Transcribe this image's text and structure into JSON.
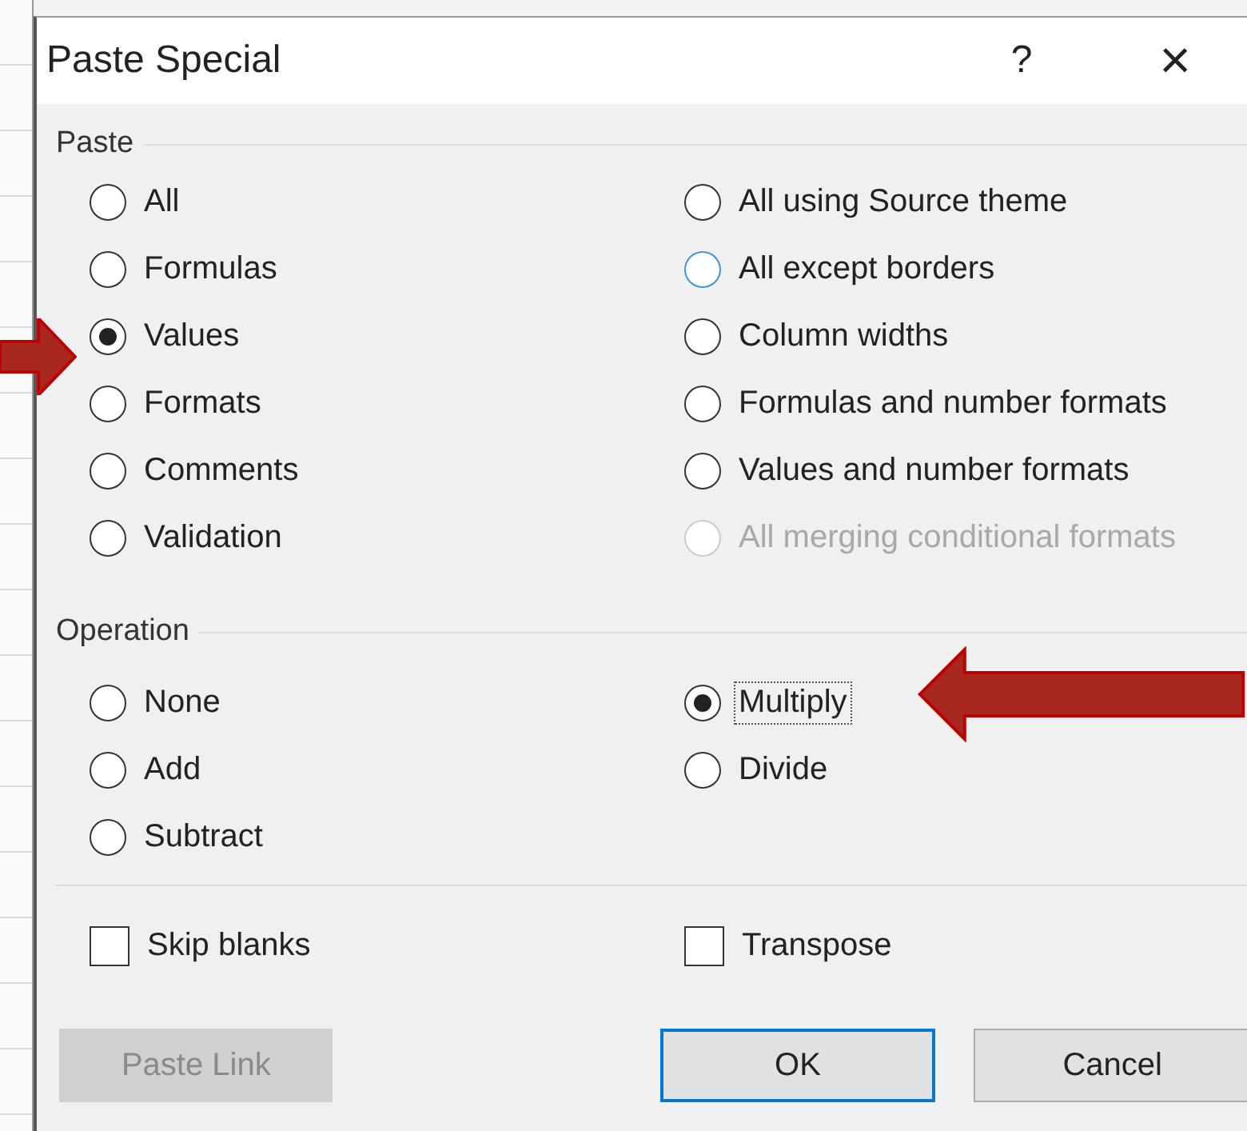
{
  "window": {
    "title": "Paste Special",
    "help": "?",
    "close": "×"
  },
  "paste": {
    "label": "Paste",
    "left": [
      {
        "label": "All",
        "selected": false,
        "disabled": false,
        "hover": false
      },
      {
        "label": "Formulas",
        "selected": false,
        "disabled": false,
        "hover": false
      },
      {
        "label": "Values",
        "selected": true,
        "disabled": false,
        "hover": false
      },
      {
        "label": "Formats",
        "selected": false,
        "disabled": false,
        "hover": false
      },
      {
        "label": "Comments",
        "selected": false,
        "disabled": false,
        "hover": false
      },
      {
        "label": "Validation",
        "selected": false,
        "disabled": false,
        "hover": false
      }
    ],
    "right": [
      {
        "label": "All using Source theme",
        "selected": false,
        "disabled": false,
        "hover": false
      },
      {
        "label": "All except borders",
        "selected": false,
        "disabled": false,
        "hover": true
      },
      {
        "label": "Column widths",
        "selected": false,
        "disabled": false,
        "hover": false
      },
      {
        "label": "Formulas and number formats",
        "selected": false,
        "disabled": false,
        "hover": false
      },
      {
        "label": "Values and number formats",
        "selected": false,
        "disabled": false,
        "hover": false
      },
      {
        "label": "All merging conditional formats",
        "selected": false,
        "disabled": true,
        "hover": false
      }
    ]
  },
  "operation": {
    "label": "Operation",
    "left": [
      {
        "label": "None",
        "selected": false,
        "focused": false
      },
      {
        "label": "Add",
        "selected": false,
        "focused": false
      },
      {
        "label": "Subtract",
        "selected": false,
        "focused": false
      }
    ],
    "right": [
      {
        "label": "Multiply",
        "selected": true,
        "focused": true
      },
      {
        "label": "Divide",
        "selected": false,
        "focused": false
      }
    ]
  },
  "checkboxes": [
    {
      "label": "Skip blanks",
      "checked": false
    },
    {
      "label": "Transpose",
      "checked": false
    }
  ],
  "buttons": [
    {
      "label": "Paste Link",
      "disabled": true,
      "default": false
    },
    {
      "label": "OK",
      "disabled": false,
      "default": true
    },
    {
      "label": "Cancel",
      "disabled": false,
      "default": false
    }
  ]
}
